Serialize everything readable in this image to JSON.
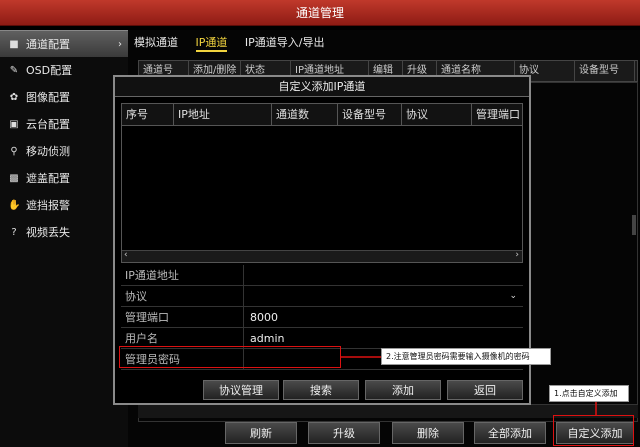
{
  "window": {
    "title": "通道管理"
  },
  "sidebar": {
    "items": [
      {
        "label": "通道配置",
        "icon": "camera-icon",
        "active": true
      },
      {
        "label": "OSD配置",
        "icon": "osd-icon"
      },
      {
        "label": "图像配置",
        "icon": "image-icon"
      },
      {
        "label": "云台配置",
        "icon": "ptz-icon"
      },
      {
        "label": "移动侦测",
        "icon": "motion-icon"
      },
      {
        "label": "遮盖配置",
        "icon": "mask-icon"
      },
      {
        "label": "遮挡报警",
        "icon": "hand-icon"
      },
      {
        "label": "视频丢失",
        "icon": "video-loss-icon"
      }
    ]
  },
  "tabs": [
    {
      "label": "模拟通道"
    },
    {
      "label": "IP通道",
      "active": true
    },
    {
      "label": "IP通道导入/导出"
    }
  ],
  "background_table": {
    "headers": [
      "通道号",
      "添加/删除",
      "状态",
      "IP通道地址",
      "编辑",
      "升级",
      "通道名称",
      "协议",
      "设备型号"
    ]
  },
  "bottom_buttons": {
    "refresh": "刷新",
    "upgrade": "升级",
    "delete": "删除",
    "add_all": "全部添加",
    "custom_add": "自定义添加"
  },
  "dialog": {
    "title": "自定义添加IP通道",
    "table_headers": [
      "序号",
      "IP地址",
      "通道数",
      "设备型号",
      "协议",
      "管理端口"
    ],
    "form": {
      "ip_label": "IP通道地址",
      "ip_value": "",
      "protocol_label": "协议",
      "protocol_value": "",
      "port_label": "管理端口",
      "port_value": "8000",
      "user_label": "用户名",
      "user_value": "admin",
      "password_label": "管理员密码",
      "password_value": ""
    },
    "buttons": {
      "protocol_mgmt": "协议管理",
      "search": "搜索",
      "add": "添加",
      "back": "返回"
    }
  },
  "annotations": {
    "note1": "1.点击自定义添加",
    "note2": "2.注意管理员密码需要输入摄像机的密码"
  },
  "colors": {
    "accent": "#f2d43f",
    "title_bar": "#b02a20",
    "annotation": "#dd1111"
  }
}
